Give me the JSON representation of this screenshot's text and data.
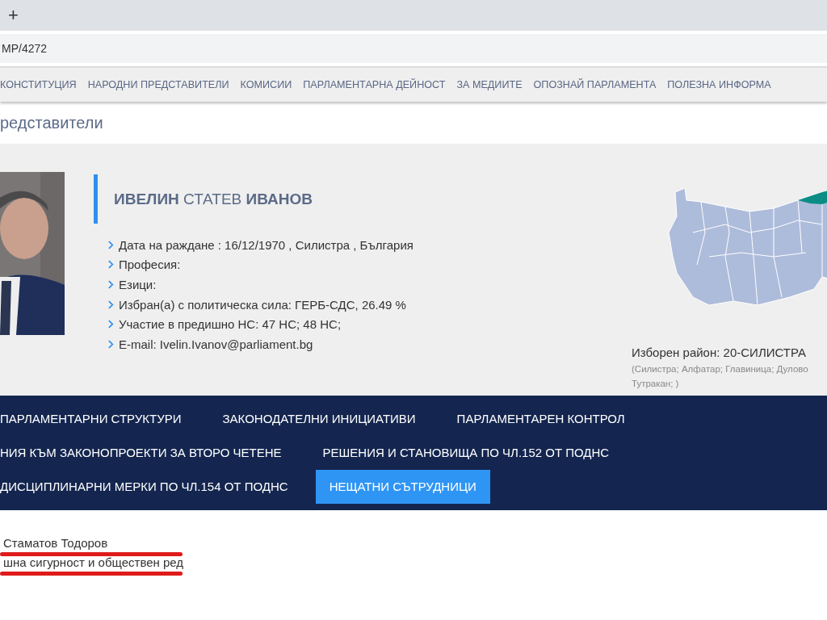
{
  "browser": {
    "new_tab": "+",
    "address": "MP/4272"
  },
  "menu": [
    "КОНСТИТУЦИЯ",
    "НАРОДНИ ПРЕДСТАВИТЕЛИ",
    "КОМИСИИ",
    "ПАРЛАМЕНТАРНА ДЕЙНОСТ",
    "ЗА МЕДИИТЕ",
    "ОПОЗНАЙ ПАРЛАМЕНТА",
    "ПОЛЕЗНА ИНФОРМА"
  ],
  "page_title": "редставители",
  "profile": {
    "photo": {
      "kind": "picture"
    },
    "name": "**ИВЕЛИН** СТАТЕВ **ИВАНОВ**",
    "facts": [
      "Дата на раждане : 16/12/1970 , Силистра , България",
      "Професия:",
      "Езици:",
      "Избран(а) с политическа сила: ГЕРБ-СДС, 26.49 %",
      "Участие в предишно НС: 47 НС; 48 НС;",
      "E-mail: Ivelin.Ivanov@parliament.bg"
    ],
    "district": "Изборен район: 20-СИЛИСТРА",
    "municipalities": "(Силистра; Алфатар; Главиница; Дулово",
    "municipalities_2": "Тутракан; )"
  },
  "tabs": [
    {
      "label": "ПАРЛАМЕНТАРНИ СТРУКТУРИ",
      "selected": false
    },
    {
      "label": "ЗАКОНОДАТЕЛНИ ИНИЦИАТИВИ",
      "selected": false
    },
    {
      "label": "ПАРЛАМЕНТАРЕН КОНТРОЛ",
      "selected": false
    },
    {
      "label": "НИЯ КЪМ ЗАКОНОПРОЕКТИ ЗА ВТОРО ЧЕТЕНЕ",
      "selected": false
    },
    {
      "label": "РЕШЕНИЯ И СТАНОВИЩА ПО ЧЛ.152 ОТ ПОДНС",
      "selected": false
    },
    {
      "label": "ДИСЦИПЛИНАРНИ МЕРКИ ПО ЧЛ.154 ОТ ПОДНС",
      "selected": false
    },
    {
      "label": "НЕЩАТНИ СЪТРУДНИЦИ",
      "selected": true
    }
  ],
  "content_lines": [
    "Стаматов Тодоров",
    "шна сигурност и обществен ред"
  ]
}
